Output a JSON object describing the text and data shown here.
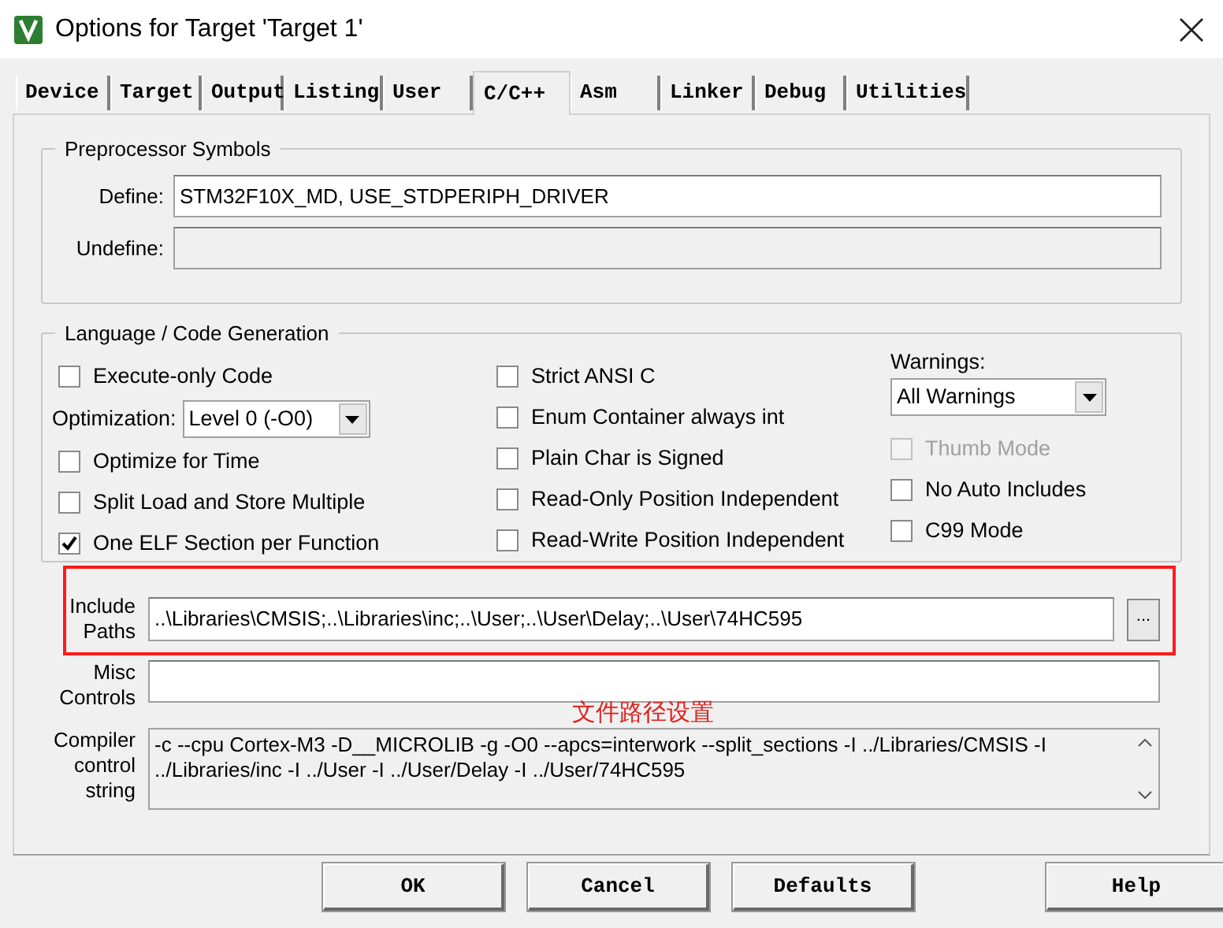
{
  "window": {
    "title": "Options for Target 'Target 1'"
  },
  "tabs": [
    {
      "label": "Device",
      "selected": false
    },
    {
      "label": "Target",
      "selected": false
    },
    {
      "label": "Output",
      "selected": false
    },
    {
      "label": "Listing",
      "selected": false
    },
    {
      "label": "User",
      "selected": false
    },
    {
      "label": "C/C++",
      "selected": true
    },
    {
      "label": "Asm",
      "selected": false
    },
    {
      "label": "Linker",
      "selected": false
    },
    {
      "label": "Debug",
      "selected": false
    },
    {
      "label": "Utilities",
      "selected": false
    }
  ],
  "preprocessor": {
    "title": "Preprocessor Symbols",
    "define": {
      "label": "Define:",
      "value": "STM32F10X_MD, USE_STDPERIPH_DRIVER"
    },
    "undefine": {
      "label": "Undefine:",
      "disabled": true
    }
  },
  "language": {
    "title": "Language / Code Generation",
    "column_1": [
      {
        "kind": "checkbox",
        "label": "Execute-only Code",
        "checked": false,
        "disabled": false
      },
      {
        "kind": "select",
        "label": "Optimization:",
        "value": "Level 0 (-O0)"
      },
      {
        "kind": "checkbox",
        "label": "Optimize for Time",
        "checked": false,
        "disabled": false
      },
      {
        "kind": "checkbox",
        "label": "Split Load and Store Multiple",
        "checked": false,
        "disabled": false
      },
      {
        "kind": "checkbox",
        "label": "One ELF Section per Function",
        "checked": true,
        "disabled": false
      }
    ],
    "column_2": [
      {
        "kind": "checkbox",
        "label": "Strict ANSI C",
        "checked": false,
        "disabled": false
      },
      {
        "kind": "checkbox",
        "label": "Enum Container always int",
        "checked": false,
        "disabled": false
      },
      {
        "kind": "checkbox",
        "label": "Plain Char is Signed",
        "checked": false,
        "disabled": false
      },
      {
        "kind": "checkbox",
        "label": "Read-Only Position Independent",
        "checked": false,
        "disabled": false
      },
      {
        "kind": "checkbox",
        "label": "Read-Write Position Independent",
        "checked": false,
        "disabled": false
      }
    ],
    "column_3": [
      {
        "kind": "select",
        "label": "Warnings:",
        "value": "All Warnings"
      },
      {
        "kind": "checkbox",
        "label": "Thumb Mode",
        "checked": false,
        "disabled": true
      },
      {
        "kind": "checkbox",
        "label": "No Auto Includes",
        "checked": false,
        "disabled": false
      },
      {
        "kind": "checkbox",
        "label": "C99 Mode",
        "checked": false,
        "disabled": false
      }
    ]
  },
  "include_paths": {
    "label_lines": [
      "Include",
      "Paths"
    ],
    "value": "..\\Libraries\\CMSIS;..\\Libraries\\inc;..\\User;..\\User\\Delay;..\\User\\74HC595",
    "browse": "..."
  },
  "misc_controls": {
    "label_lines": [
      "Misc",
      "Controls"
    ]
  },
  "annotation": "文件路径设置",
  "compiler_string": {
    "label_lines": [
      "Compiler",
      "control",
      "string"
    ],
    "lines": [
      "-c --cpu Cortex-M3 -D__MICROLIB -g -O0 --apcs=interwork --split_sections -I ../Libraries/CMSIS -I",
      "../Libraries/inc -I ../User -I ../User/Delay -I ../User/74HC595"
    ]
  },
  "buttons": [
    "OK",
    "Cancel",
    "Defaults",
    "Help"
  ]
}
